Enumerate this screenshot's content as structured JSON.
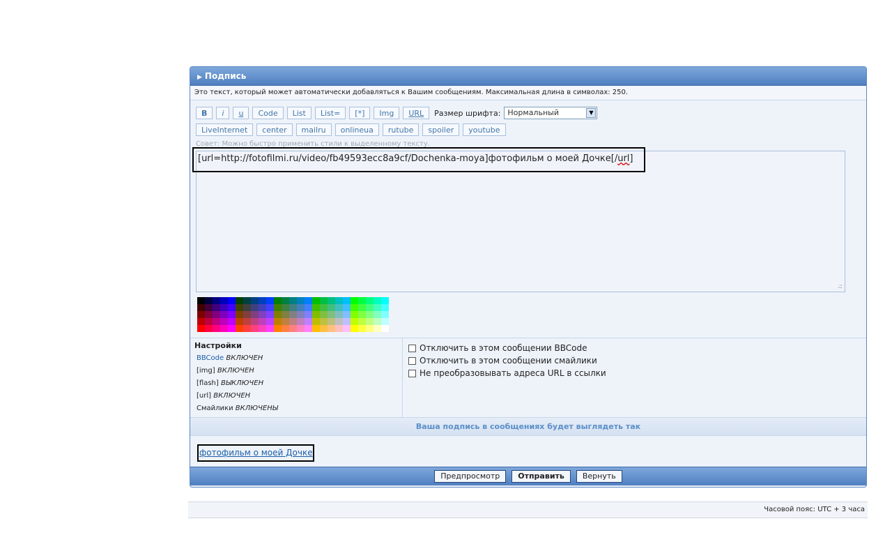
{
  "panel": {
    "title": "Подпись",
    "description": "Это текст, который может автоматически добавляться к Вашим сообщениям. Максимальная длина в символах: 250."
  },
  "toolbar": {
    "row1": [
      "B",
      "i",
      "u",
      "Code",
      "List",
      "List=",
      "[*]",
      "Img",
      "URL"
    ],
    "row2": [
      "LiveInternet",
      "center",
      "mailru",
      "onlineua",
      "rutube",
      "spoiler",
      "youtube"
    ],
    "font_size_label": "Размер шрифта:",
    "font_size_value": "Нормальный",
    "hint": "Совет: Можно быстро применить стили к выделенному тексту."
  },
  "editor": {
    "text_before": "[url=http://fotofilmi.ru/video/fb49593ecc8a9cf/Dochenka-moya]фотофильм о моей Дочке[/",
    "text_misspelled": "url",
    "text_after": "]"
  },
  "palette_colors": [
    "#000000",
    "#000040",
    "#000080",
    "#0000bf",
    "#0000ff",
    "#004000",
    "#004040",
    "#004080",
    "#0040bf",
    "#0040ff",
    "#008000",
    "#008040",
    "#008080",
    "#0080bf",
    "#0080ff",
    "#00bf00",
    "#00bf40",
    "#00bf80",
    "#00bfbf",
    "#00bfff",
    "#00ff00",
    "#00ff40",
    "#00ff80",
    "#00ffbf",
    "#00ffff",
    "#400000",
    "#400040",
    "#400080",
    "#4000bf",
    "#4000ff",
    "#404000",
    "#404040",
    "#404080",
    "#4040bf",
    "#4040ff",
    "#408000",
    "#408040",
    "#408080",
    "#4080bf",
    "#4080ff",
    "#40bf00",
    "#40bf40",
    "#40bf80",
    "#40bfbf",
    "#40bfff",
    "#40ff00",
    "#40ff40",
    "#40ff80",
    "#40ffbf",
    "#40ffff",
    "#800000",
    "#800040",
    "#800080",
    "#8000bf",
    "#8000ff",
    "#804000",
    "#804040",
    "#804080",
    "#8040bf",
    "#8040ff",
    "#808000",
    "#808040",
    "#808080",
    "#8080bf",
    "#8080ff",
    "#80bf00",
    "#80bf40",
    "#80bf80",
    "#80bfbf",
    "#80bfff",
    "#80ff00",
    "#80ff40",
    "#80ff80",
    "#80ffbf",
    "#80ffff",
    "#bf0000",
    "#bf0040",
    "#bf0080",
    "#bf00bf",
    "#bf00ff",
    "#bf4000",
    "#bf4040",
    "#bf4080",
    "#bf40bf",
    "#bf40ff",
    "#bf8000",
    "#bf8040",
    "#bf8080",
    "#bf80bf",
    "#bf80ff",
    "#bfbf00",
    "#bfbf40",
    "#bfbf80",
    "#bfbfbf",
    "#bfbfff",
    "#bfff00",
    "#bfff40",
    "#bfff80",
    "#bfffbf",
    "#bfffff",
    "#ff0000",
    "#ff0040",
    "#ff0080",
    "#ff00bf",
    "#ff00ff",
    "#ff4000",
    "#ff4040",
    "#ff4080",
    "#ff40bf",
    "#ff40ff",
    "#ff8000",
    "#ff8040",
    "#ff8080",
    "#ff80bf",
    "#ff80ff",
    "#ffbf00",
    "#ffbf40",
    "#ffbf80",
    "#ffbfbf",
    "#ffbfff",
    "#ffff00",
    "#ffff40",
    "#ffff80",
    "#ffffbf",
    "#ffffff"
  ],
  "settings": {
    "title": "Настройки",
    "bbcode": "BBCode",
    "bbcode_state": "ВКЛЮЧЕН",
    "img": "[img]",
    "img_state": "ВКЛЮЧЕН",
    "flash": "[flash]",
    "flash_state": "ВЫКЛЮЧЕН",
    "url": "[url]",
    "url_state": "ВКЛЮЧЕН",
    "smilies": "Смайлики",
    "smilies_state": "ВКЛЮЧЕНЫ"
  },
  "options": {
    "disable_bbcode": "Отключить в этом сообщении BBCode",
    "disable_smilies": "Отключить в этом сообщении смайлики",
    "no_autolink": "Не преобразовывать адреса URL в ссылки"
  },
  "preview": {
    "heading": "Ваша подпись в сообщениях будет выглядеть так",
    "link_text": "фотофильм о моей Дочке"
  },
  "footer": {
    "preview_btn": "Предпросмотр",
    "submit_btn": "Отправить",
    "back_btn": "Вернуть"
  },
  "timezone": "Часовой пояс: UTC + 3 часа"
}
